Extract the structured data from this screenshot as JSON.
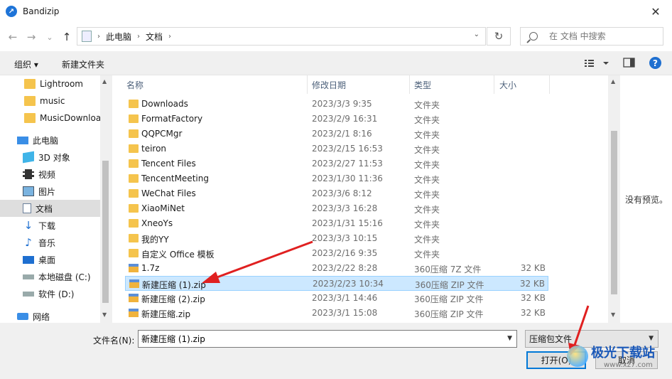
{
  "window": {
    "title": "Bandizip",
    "close_glyph": "✕"
  },
  "navigation": {
    "back_glyph": "←",
    "forward_glyph": "→",
    "recent_glyph": "⌄",
    "up_glyph": "↑",
    "breadcrumbs": [
      "此电脑",
      "文档"
    ],
    "refresh_glyph": "↻",
    "search_placeholder": "在 文档 中搜索"
  },
  "toolbar": {
    "organize_label": "组织 ▾",
    "new_folder_label": "新建文件夹",
    "view_glyph": "▾"
  },
  "sidebar": {
    "items": [
      {
        "label": "Lightroom",
        "icon": "folder-icon"
      },
      {
        "label": "music",
        "icon": "folder-icon"
      },
      {
        "label": "MusicDownloa",
        "icon": "folder-icon"
      },
      {
        "label": "此电脑",
        "icon": "computer-icon"
      },
      {
        "label": "3D 对象",
        "icon": "3d-objects-icon"
      },
      {
        "label": "视频",
        "icon": "video-icon"
      },
      {
        "label": "图片",
        "icon": "pictures-icon"
      },
      {
        "label": "文档",
        "icon": "documents-icon",
        "active": true
      },
      {
        "label": "下载",
        "icon": "download-icon"
      },
      {
        "label": "音乐",
        "icon": "music-icon"
      },
      {
        "label": "桌面",
        "icon": "desktop-icon"
      },
      {
        "label": "本地磁盘 (C:)",
        "icon": "drive-icon"
      },
      {
        "label": "软件 (D:)",
        "icon": "drive-icon"
      },
      {
        "label": "网络",
        "icon": "network-icon"
      }
    ]
  },
  "filelist": {
    "columns": {
      "name": "名称",
      "date": "修改日期",
      "type": "类型",
      "size": "大小"
    },
    "rows": [
      {
        "name": "Downloads",
        "date": "2023/3/3 9:35",
        "type": "文件夹",
        "size": "",
        "kind": "folder"
      },
      {
        "name": "FormatFactory",
        "date": "2023/2/9 16:31",
        "type": "文件夹",
        "size": "",
        "kind": "folder"
      },
      {
        "name": "QQPCMgr",
        "date": "2023/2/1 8:16",
        "type": "文件夹",
        "size": "",
        "kind": "folder"
      },
      {
        "name": "teiron",
        "date": "2023/2/15 16:53",
        "type": "文件夹",
        "size": "",
        "kind": "folder"
      },
      {
        "name": "Tencent Files",
        "date": "2023/2/27 11:53",
        "type": "文件夹",
        "size": "",
        "kind": "folder"
      },
      {
        "name": "TencentMeeting",
        "date": "2023/1/30 11:36",
        "type": "文件夹",
        "size": "",
        "kind": "folder"
      },
      {
        "name": "WeChat Files",
        "date": "2023/3/6 8:12",
        "type": "文件夹",
        "size": "",
        "kind": "folder"
      },
      {
        "name": "XiaoMiNet",
        "date": "2023/3/3 16:28",
        "type": "文件夹",
        "size": "",
        "kind": "folder"
      },
      {
        "name": "XneoYs",
        "date": "2023/1/31 15:16",
        "type": "文件夹",
        "size": "",
        "kind": "folder"
      },
      {
        "name": "我的YY",
        "date": "2023/3/3 10:15",
        "type": "文件夹",
        "size": "",
        "kind": "folder"
      },
      {
        "name": "自定义 Office 模板",
        "date": "2023/2/16 9:35",
        "type": "文件夹",
        "size": "",
        "kind": "folder"
      },
      {
        "name": "1.7z",
        "date": "2023/2/22 8:28",
        "type": "360压缩 7Z 文件",
        "size": "32 KB",
        "kind": "archive"
      },
      {
        "name": "新建压缩 (1).zip",
        "date": "2023/2/23 10:34",
        "type": "360压缩 ZIP 文件",
        "size": "32 KB",
        "kind": "archive",
        "selected": true
      },
      {
        "name": "新建压缩 (2).zip",
        "date": "2023/3/1 14:46",
        "type": "360压缩 ZIP 文件",
        "size": "32 KB",
        "kind": "archive"
      },
      {
        "name": "新建压缩.zip",
        "date": "2023/3/1 15:08",
        "type": "360压缩 ZIP 文件",
        "size": "32 KB",
        "kind": "archive"
      }
    ]
  },
  "preview": {
    "empty_text": "没有预览。"
  },
  "footer": {
    "filename_label": "文件名(N):",
    "filename_value": "新建压缩 (1).zip",
    "filetype_value": "压缩包文件",
    "open_label": "打开(O)",
    "cancel_label": "取消"
  },
  "watermark": {
    "text": "极光下载站",
    "url": "www.xz7.com"
  },
  "colors": {
    "selection_bg": "#cce8ff",
    "accent": "#0078d7",
    "annotation_arrow": "#e02020"
  }
}
